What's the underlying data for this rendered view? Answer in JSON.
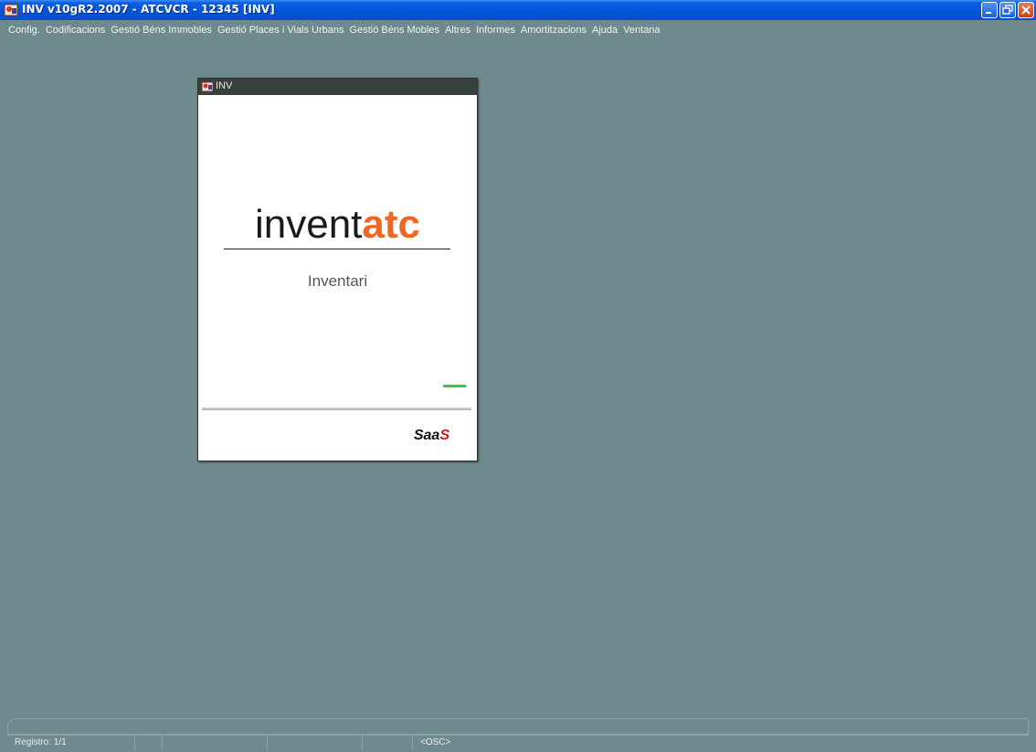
{
  "window": {
    "title": "INV v10gR2.2007 - ATCVCR - 12345 [INV]"
  },
  "menu": [
    {
      "label": "Config."
    },
    {
      "label": "Codificacions"
    },
    {
      "label": "Gestió Béns Immobles"
    },
    {
      "label": "Gestió Places i Vials Urbans"
    },
    {
      "label": "Gestió Béns Mobles"
    },
    {
      "label": "Altres"
    },
    {
      "label": "Informes"
    },
    {
      "label": "Amortitzacions"
    },
    {
      "label": "Ajuda"
    },
    {
      "label": "Ventana"
    }
  ],
  "splash": {
    "title": "INV",
    "logo_main": "invent",
    "logo_accent": "atc",
    "subtitle": "Inventari",
    "saas_main": "Saa",
    "saas_accent": "S",
    "accent_color": "#f26522"
  },
  "status": {
    "record": "Registro: 1/1",
    "mode": "<OSC>"
  },
  "colors": {
    "background": "#6e8a8c",
    "titlebar": "#0553d8"
  }
}
